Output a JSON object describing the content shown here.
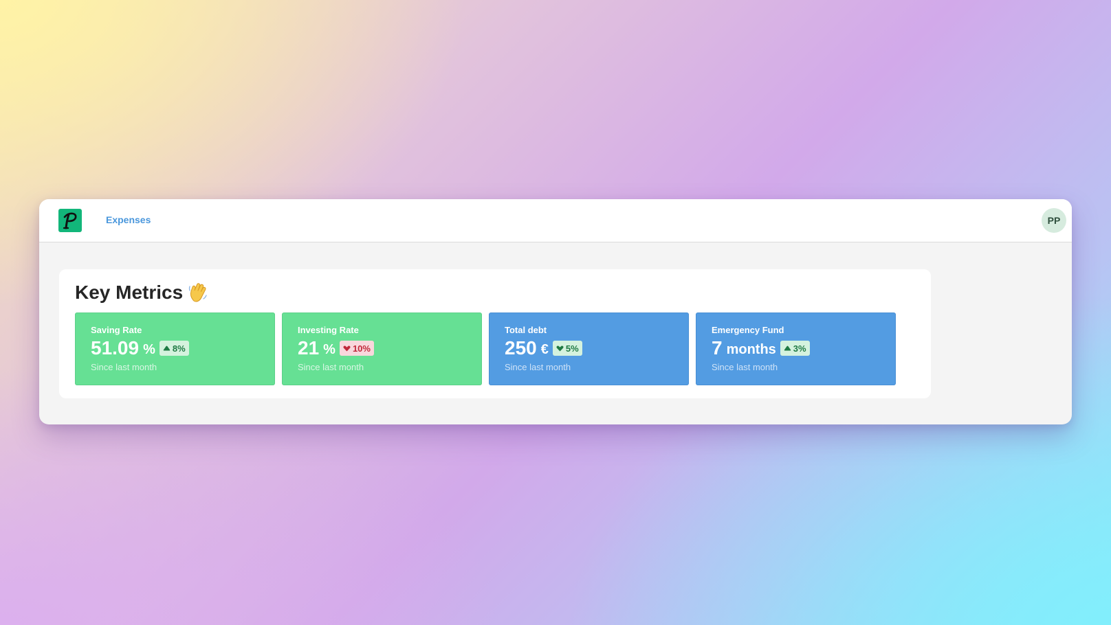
{
  "colors": {
    "green_card": "#66e094",
    "blue_card": "#539ce2",
    "logo_bg": "#12b67a",
    "nav_link": "#4a97dc",
    "badge_up_text": "#1f7a44",
    "badge_down_text": "#c0283a"
  },
  "topbar": {
    "logo_icon": "p-logo-icon",
    "logo_letter": "P",
    "nav": [
      {
        "label": "Expenses"
      }
    ],
    "avatar_initials": "PP"
  },
  "panel": {
    "title": "Key Metrics",
    "title_icon": "waving-hand-icon"
  },
  "cards": [
    {
      "label": "Saving Rate",
      "value": "51.09",
      "unit": "%",
      "trend": "up",
      "trend_icon": "arrow-up-icon",
      "change": "8%",
      "subtitle": "Since last month",
      "color": "green"
    },
    {
      "label": "Investing Rate",
      "value": "21",
      "unit": "%",
      "trend": "down",
      "trend_icon": "arrow-down-icon",
      "change": "10%",
      "subtitle": "Since last month",
      "color": "green"
    },
    {
      "label": "Total debt",
      "value": "250",
      "unit": "€",
      "trend": "down",
      "trend_icon": "arrow-down-icon",
      "change": "5%",
      "subtitle": "Since last month",
      "color": "blue"
    },
    {
      "label": "Emergency Fund",
      "value": "7",
      "unit": "months",
      "trend": "up",
      "trend_icon": "arrow-up-icon",
      "change": "3%",
      "subtitle": "Since last month",
      "color": "blue"
    }
  ]
}
